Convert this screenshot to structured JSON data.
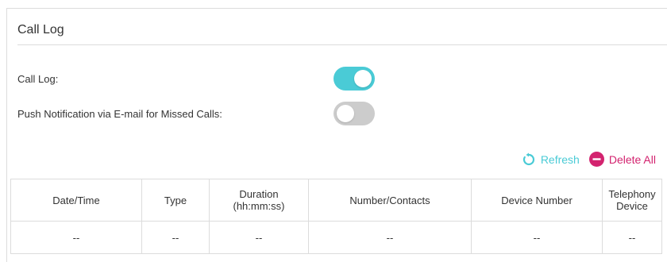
{
  "panel": {
    "title": "Call Log"
  },
  "settings": [
    {
      "label": "Call Log:",
      "enabled": true
    },
    {
      "label": "Push Notification via E-mail for Missed Calls:",
      "enabled": false
    }
  ],
  "colors": {
    "accent": "#4acbd6",
    "toggle_off": "#cccccc",
    "delete": "#d3236f"
  },
  "actions": {
    "refresh_label": "Refresh",
    "refresh_icon": "refresh-icon",
    "delete_all_label": "Delete All",
    "delete_icon": "minus-circle-icon"
  },
  "table": {
    "columns": [
      "Date/Time",
      "Type",
      "Duration\n(hh:mm:ss)",
      "Number/Contacts",
      "Device Number",
      "Telephony\nDevice"
    ],
    "rows": [
      [
        "--",
        "--",
        "--",
        "--",
        "--",
        "--"
      ]
    ]
  }
}
